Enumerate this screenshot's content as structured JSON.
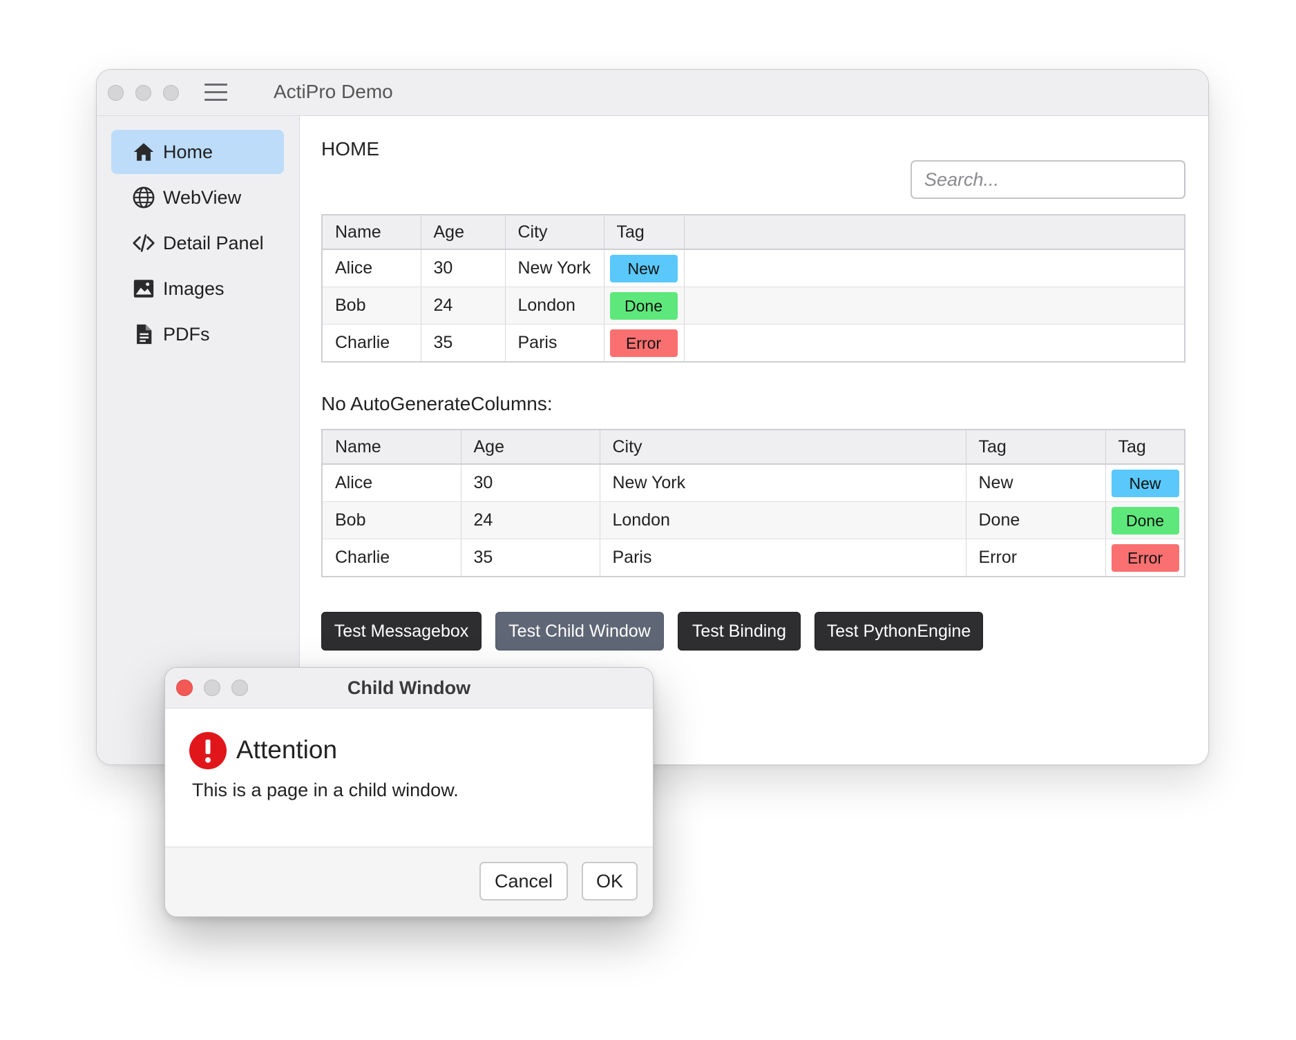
{
  "window": {
    "title": "ActiPro Demo"
  },
  "sidebar": {
    "items": [
      {
        "label": "Home",
        "icon": "home-icon",
        "active": true
      },
      {
        "label": "WebView",
        "icon": "globe-icon",
        "active": false
      },
      {
        "label": "Detail Panel",
        "icon": "code-icon",
        "active": false
      },
      {
        "label": "Images",
        "icon": "image-icon",
        "active": false
      },
      {
        "label": "PDFs",
        "icon": "document-icon",
        "active": false
      }
    ]
  },
  "main": {
    "page_title": "HOME",
    "search": {
      "placeholder": "Search...",
      "value": ""
    },
    "table1": {
      "columns": [
        "Name",
        "Age",
        "City",
        "Tag"
      ],
      "rows": [
        {
          "name": "Alice",
          "age": "30",
          "city": "New York",
          "tag": "New"
        },
        {
          "name": "Bob",
          "age": "24",
          "city": "London",
          "tag": "Done"
        },
        {
          "name": "Charlie",
          "age": "35",
          "city": "Paris",
          "tag": "Error"
        }
      ]
    },
    "section_label": "No AutoGenerateColumns:",
    "table2": {
      "columns": [
        "Name",
        "Age",
        "City",
        "Tag",
        "Tag"
      ],
      "rows": [
        {
          "name": "Alice",
          "age": "30",
          "city": "New York",
          "tag_text": "New",
          "tag": "New"
        },
        {
          "name": "Bob",
          "age": "24",
          "city": "London",
          "tag_text": "Done",
          "tag": "Done"
        },
        {
          "name": "Charlie",
          "age": "35",
          "city": "Paris",
          "tag_text": "Error",
          "tag": "Error"
        }
      ]
    },
    "buttons": [
      {
        "label": "Test Messagebox",
        "selected": false
      },
      {
        "label": "Test Child Window",
        "selected": true
      },
      {
        "label": "Test Binding",
        "selected": false
      },
      {
        "label": "Test PythonEngine",
        "selected": false
      }
    ]
  },
  "tag_colors": {
    "New": "#5ac8fa",
    "Done": "#5ee87c",
    "Error": "#fa7070"
  },
  "child_window": {
    "title": "Child Window",
    "alert_title": "Attention",
    "alert_icon": "exclamation-circle-icon",
    "alert_color": "#e0161b",
    "message": "This is a page in a child window.",
    "cancel_label": "Cancel",
    "ok_label": "OK"
  }
}
